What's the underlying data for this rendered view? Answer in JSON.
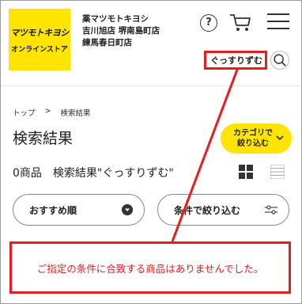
{
  "header": {
    "logo_line1": "マツモトキヨシ",
    "logo_line2": "オンラインストア",
    "store_lines": [
      "薬マツモトキヨシ",
      "吉川旭店 堺南島町店",
      "練馬春日町店"
    ],
    "help_symbol": "?",
    "search_value": "ぐっすりずむ"
  },
  "breadcrumb": {
    "home": "トップ",
    "separator": ">",
    "current": "検索結果"
  },
  "page_title": "検索結果",
  "category_button": {
    "line1": "カテゴリで",
    "line2": "絞り込む"
  },
  "result_summary": "0商品　検索結果\"ぐっすりずむ\"",
  "sort_button": "おすすめ順",
  "filter_button": "条件で絞り込む",
  "no_results_message": "ご指定の条件に合致する商品はありませんでした。",
  "colors": {
    "brand_yellow": "#ffe400",
    "highlight_red": "#e41e1e"
  },
  "icons": [
    "help-icon",
    "cart-icon",
    "menu-icon",
    "search-icon",
    "chevron-down-icon",
    "grid-view-icon",
    "list-view-icon",
    "sort-down-icon",
    "filter-sliders-icon"
  ]
}
